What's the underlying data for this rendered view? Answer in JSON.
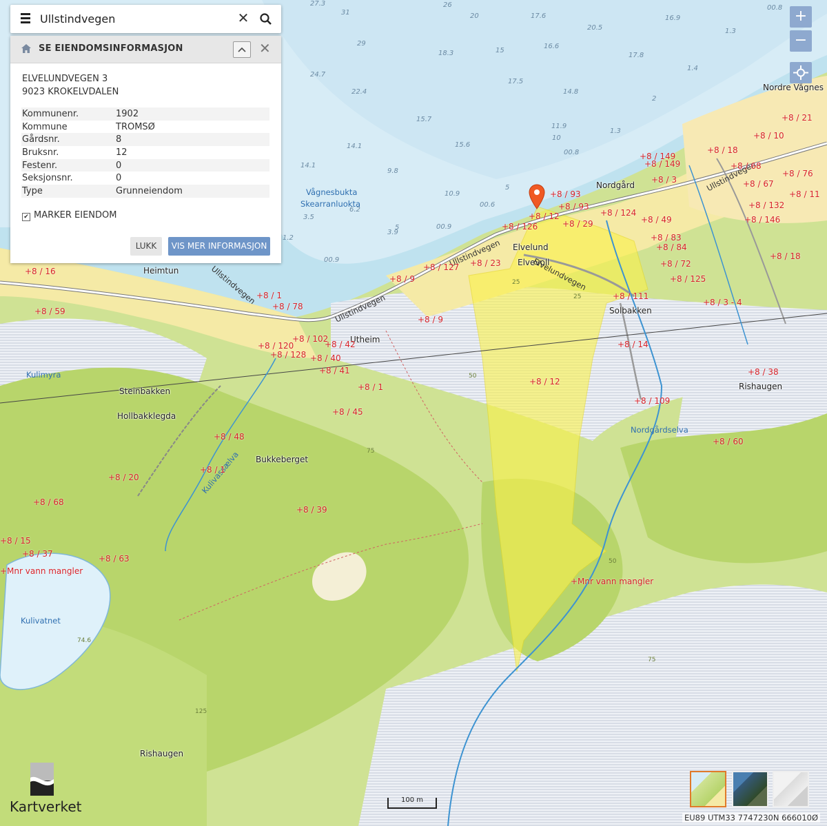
{
  "search": {
    "query": "Ullstindvegen"
  },
  "panel": {
    "title": "SE EIENDOMSINFORMASJON",
    "address_line1": "ELVELUNDVEGEN 3",
    "address_line2": "9023 KROKELVDALEN",
    "rows": [
      {
        "key": "Kommunenr.",
        "value": "1902"
      },
      {
        "key": "Kommune",
        "value": "TROMSØ"
      },
      {
        "key": "Gårdsnr.",
        "value": "8"
      },
      {
        "key": "Bruksnr.",
        "value": "12"
      },
      {
        "key": "Festenr.",
        "value": "0"
      },
      {
        "key": "Seksjonsnr.",
        "value": "0"
      },
      {
        "key": "Type",
        "value": "Grunneiendom"
      }
    ],
    "checkbox_label": "MARKER EIENDOM",
    "checkbox_checked": true,
    "close_button": "LUKK",
    "more_button": "VIS MER INFORMASJON"
  },
  "zoom": {
    "in": "+",
    "out": "−"
  },
  "logo_text": "Kartverket",
  "scale_label": "100 m",
  "coordinates": "EU89 UTM33 7747230N 666010Ø",
  "map_labels": {
    "places": [
      "Nordre Vågnes",
      "Nordgård",
      "Heimtun",
      "Elvelund",
      "Elvevoll",
      "Utheim",
      "Solbakken",
      "Steinbakken",
      "Hollbakklegda",
      "Bukkeberget",
      "Rishaugen",
      "Rishaugen"
    ],
    "water": [
      "Vågnesbukta",
      "Skearranluokta",
      "Kulimyra",
      "Kulivassælva",
      "Nordgårdselva",
      "Kulivatnet"
    ],
    "roads": [
      "Ullstindvegen",
      "Ullstindvegen",
      "Ullstindvegen",
      "Ullstindvegen",
      "Elvelundvegen"
    ],
    "properties": [
      "8 / 21",
      "8 / 10",
      "8 / 18",
      "8 / 149",
      "8 / 149",
      "8 / 68",
      "8 / 76",
      "8 / 3",
      "8 / 67",
      "8 / 11",
      "8 / 132",
      "8 / 146",
      "8 / 93",
      "8 / 93",
      "8 / 12",
      "8 / 124",
      "8 / 49",
      "8 / 29",
      "8 / 126",
      "8 / 83",
      "8 / 84",
      "8 / 72",
      "8 / 18",
      "8 / 125",
      "8 / 127",
      "8 / 23",
      "8 / 9",
      "8 / 111",
      "8 / 3 - 4",
      "8 / 9",
      "8 / 1",
      "8 / 78",
      "8 / 102",
      "8 / 42",
      "8 / 120",
      "8 / 128",
      "8 / 40",
      "8 / 41",
      "8 / 14",
      "8 / 12",
      "8 / 1",
      "8 / 45",
      "8 / 109",
      "8 / 38",
      "8 / 48",
      "8 / 20",
      "8 / 1",
      "8 / 39",
      "8 / 60",
      "8 / 59",
      "8 / 16",
      "8 / 68",
      "8 / 15",
      "8 / 37",
      "8 / 63",
      "Mnr vann mangler",
      "Mnr vann mangler"
    ],
    "depths": [
      "27.3",
      "31",
      "26",
      "20",
      "17.6",
      "20.5",
      "16.9",
      "00.8",
      "1.3",
      "29",
      "18.3",
      "15",
      "16.6",
      "17.8",
      "1.4",
      "24.7",
      "22.4",
      "17.5",
      "14.8",
      "2",
      "15.7",
      "11.9",
      "1.3",
      "14.1",
      "10",
      "15.6",
      "00.8",
      "14.1",
      "9.8",
      "5",
      "10.9",
      "00.6",
      "3.5",
      "6.2",
      "5",
      "00.9",
      "3.9",
      "1.2",
      "00.9"
    ],
    "contours": [
      "25",
      "25",
      "50",
      "75",
      "50",
      "75",
      "125",
      "74.6"
    ]
  },
  "colors": {
    "sea": "#d7ecf6",
    "land": "#cfe294",
    "forest": "#b6d46b",
    "bog": "#e9ecf2",
    "settlement": "#f7eba8",
    "highlight": "#fbf14a",
    "property_text": "#d8232a",
    "button": "#6e95c8"
  }
}
